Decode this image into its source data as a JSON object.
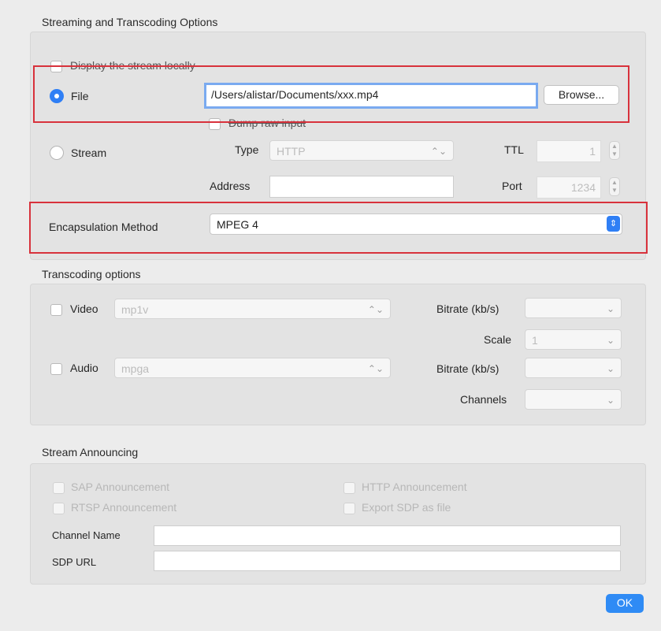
{
  "streaming": {
    "section_title": "Streaming and Transcoding Options",
    "display_locally": "Display the stream locally",
    "file_label": "File",
    "file_path": "/Users/alistar/Documents/xxx.mp4",
    "browse_label": "Browse...",
    "dump_raw": "Dump raw input",
    "stream_label": "Stream",
    "type_label": "Type",
    "type_value": "HTTP",
    "ttl_label": "TTL",
    "ttl_value": "1",
    "address_label": "Address",
    "address_value": "",
    "port_label": "Port",
    "port_value": "1234",
    "encapsulation_label": "Encapsulation Method",
    "encapsulation_value": "MPEG 4"
  },
  "transcoding": {
    "section_title": "Transcoding options",
    "video_label": "Video",
    "video_codec": "mp1v",
    "audio_label": "Audio",
    "audio_codec": "mpga",
    "bitrate_label": "Bitrate (kb/s)",
    "scale_label": "Scale",
    "scale_value": "1",
    "channels_label": "Channels"
  },
  "announcing": {
    "section_title": "Stream Announcing",
    "sap": "SAP Announcement",
    "http": "HTTP Announcement",
    "rtsp": "RTSP Announcement",
    "export_sdp": "Export SDP as file",
    "channel_name_label": "Channel Name",
    "channel_name_value": "",
    "sdp_url_label": "SDP URL",
    "sdp_url_value": ""
  },
  "ok_label": "OK",
  "colors": {
    "accent": "#2f7ff5",
    "highlight_box": "#d8323c"
  }
}
